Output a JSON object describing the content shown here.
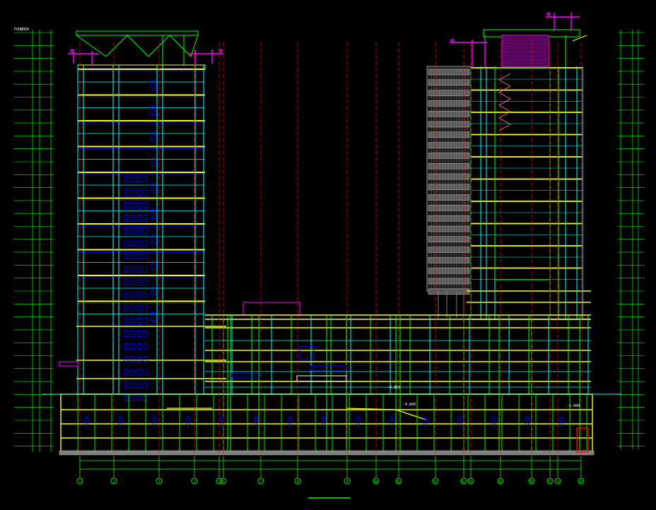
{
  "drawing": {
    "corner_label": "FOUNDER",
    "axis_labels": [
      "1",
      "2",
      "3",
      "4",
      "5",
      "6",
      "7",
      "8",
      "9",
      "10",
      "11",
      "12",
      "13",
      "14",
      "15",
      "16",
      "17",
      "18",
      "19"
    ],
    "level_tags": [
      "-4.800",
      "-4.800",
      "-5.000"
    ],
    "colors": {
      "background": "#000000",
      "slab": "#ffff00",
      "column": "#00ff00",
      "wall": "#00ffff",
      "window": "#0000ff",
      "axis": "#ff0000",
      "crane": "#ff00ff",
      "facade": "#c0c0c0",
      "dim": "#00ff00"
    }
  }
}
